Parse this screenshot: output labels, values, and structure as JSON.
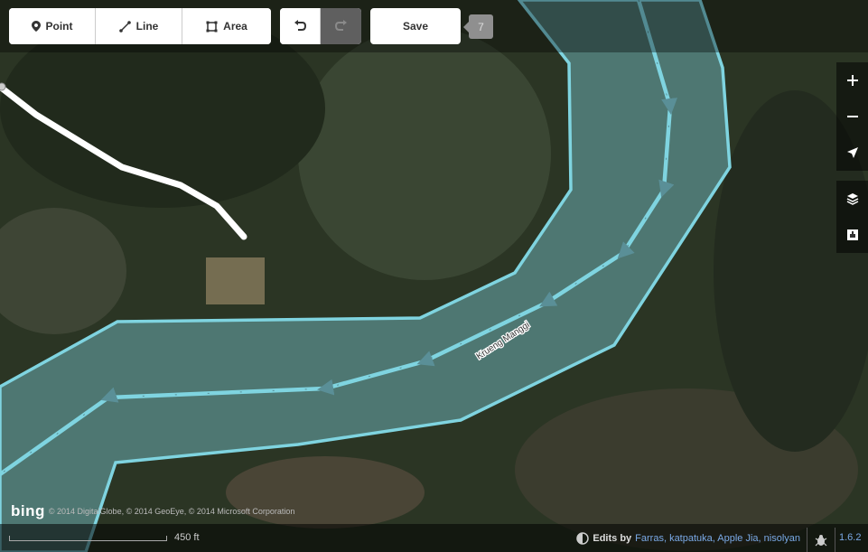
{
  "toolbar": {
    "point_label": "Point",
    "line_label": "Line",
    "area_label": "Area",
    "save_label": "Save",
    "edit_count": "7"
  },
  "map": {
    "feature_label": "Krueng Manggi",
    "water_color": "#7fd4e0"
  },
  "attribution": {
    "logo": "bing",
    "text": "© 2014 DigitalGlobe, © 2014 GeoEye, © 2014 Microsoft Corporation"
  },
  "footer": {
    "scale_label": "450 ft",
    "edits_label": "Edits by",
    "contributors": "Farras, katpatuka, Apple Jia, nisolyan",
    "version": "1.6.2"
  },
  "controls": {
    "zoom_in": "+",
    "zoom_out": "−"
  }
}
